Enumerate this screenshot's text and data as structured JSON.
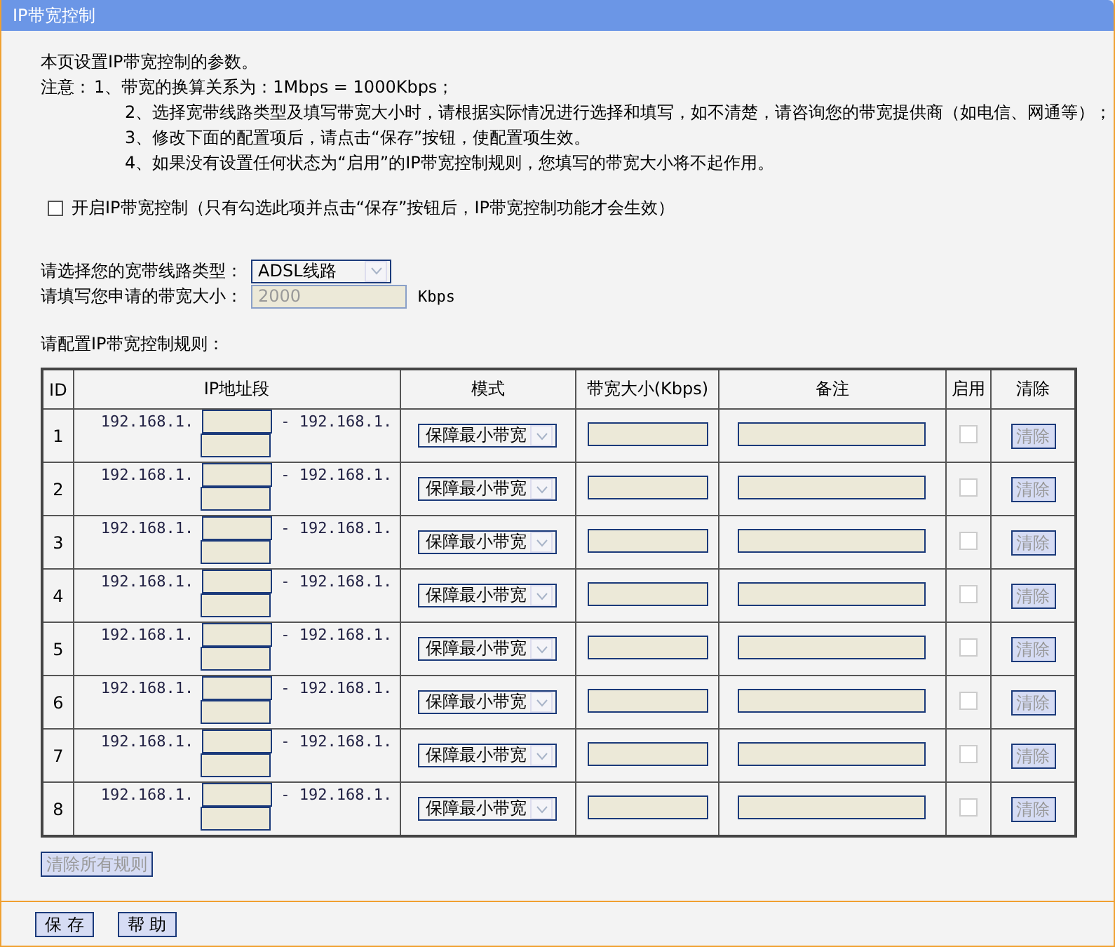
{
  "title": "IP带宽控制",
  "intro": "本页设置IP带宽控制的参数。",
  "notes_label": "注意：",
  "notes": [
    "1、带宽的换算关系为：1Mbps = 1000Kbps；",
    "2、选择宽带线路类型及填写带宽大小时，请根据实际情况进行选择和填写，如不清楚，请咨询您的带宽提供商（如电信、网通等）；",
    "3、修改下面的配置项后，请点击“保存”按钮，使配置项生效。",
    "4、如果没有设置任何状态为“启用”的IP带宽控制规则，您填写的带宽大小将不起作用。"
  ],
  "enable": {
    "label": "开启IP带宽控制（只有勾选此项并点击“保存”按钮后，IP带宽控制功能才会生效）",
    "checked": false
  },
  "line_type": {
    "label": "请选择您的宽带线路类型：",
    "value": "ADSL线路"
  },
  "bandwidth": {
    "label": "请填写您申请的带宽大小：",
    "value": "2000",
    "unit": "Kbps",
    "disabled": true
  },
  "rules_label": "请配置IP带宽控制规则：",
  "table": {
    "columns": [
      "ID",
      "IP地址段",
      "模式",
      "带宽大小(Kbps)",
      "备注",
      "启用",
      "清除"
    ],
    "rows": [
      {
        "id": "1",
        "ip_start": "192.168.1.",
        "ip_end": "- 192.168.1.",
        "mode": "保障最小带宽",
        "enabled": false,
        "clear": "清除",
        "disabled": true
      },
      {
        "id": "2",
        "ip_start": "192.168.1.",
        "ip_end": "- 192.168.1.",
        "mode": "保障最小带宽",
        "enabled": false,
        "clear": "清除",
        "disabled": true
      },
      {
        "id": "3",
        "ip_start": "192.168.1.",
        "ip_end": "- 192.168.1.",
        "mode": "保障最小带宽",
        "enabled": false,
        "clear": "清除",
        "disabled": true
      },
      {
        "id": "4",
        "ip_start": "192.168.1.",
        "ip_end": "- 192.168.1.",
        "mode": "保障最小带宽",
        "enabled": false,
        "clear": "清除",
        "disabled": true
      },
      {
        "id": "5",
        "ip_start": "192.168.1.",
        "ip_end": "- 192.168.1.",
        "mode": "保障最小带宽",
        "enabled": false,
        "clear": "清除",
        "disabled": true
      },
      {
        "id": "6",
        "ip_start": "192.168.1.",
        "ip_end": "- 192.168.1.",
        "mode": "保障最小带宽",
        "enabled": false,
        "clear": "清除",
        "disabled": true
      },
      {
        "id": "7",
        "ip_start": "192.168.1.",
        "ip_end": "- 192.168.1.",
        "mode": "保障最小带宽",
        "enabled": false,
        "clear": "清除",
        "disabled": true
      },
      {
        "id": "8",
        "ip_start": "192.168.1.",
        "ip_end": "- 192.168.1.",
        "mode": "保障最小带宽",
        "enabled": false,
        "clear": "清除",
        "disabled": true
      }
    ]
  },
  "clear_all": {
    "label": "清除所有规则",
    "disabled": true
  },
  "buttons": [
    "保 存",
    "帮 助"
  ]
}
